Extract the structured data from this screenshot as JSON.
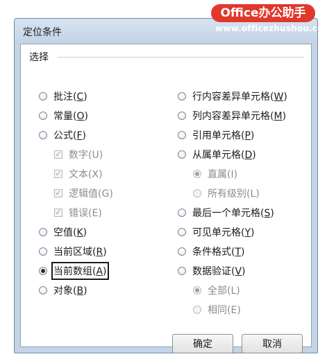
{
  "watermark": {
    "brand": "Office办公助手",
    "url": "www.officezhushou.com"
  },
  "dialog": {
    "title": "定位条件",
    "group_label": "选择"
  },
  "left_options": [
    {
      "label": "批注",
      "key": "C"
    },
    {
      "label": "常量",
      "key": "O"
    },
    {
      "label": "公式",
      "key": "F"
    },
    {
      "label": "空值",
      "key": "K"
    },
    {
      "label": "当前区域",
      "key": "R"
    },
    {
      "label": "当前数组",
      "key": "A"
    },
    {
      "label": "对象",
      "key": "B"
    }
  ],
  "formula_checks": [
    {
      "label": "数字",
      "key": "U"
    },
    {
      "label": "文本",
      "key": "X"
    },
    {
      "label": "逻辑值",
      "key": "G"
    },
    {
      "label": "错误",
      "key": "E"
    }
  ],
  "right_options": [
    {
      "label": "行内容差异单元格",
      "key": "W"
    },
    {
      "label": "列内容差异单元格",
      "key": "M"
    },
    {
      "label": "引用单元格",
      "key": "P"
    },
    {
      "label": "从属单元格",
      "key": "D"
    },
    {
      "label": "最后一个单元格",
      "key": "S"
    },
    {
      "label": "可见单元格",
      "key": "Y"
    },
    {
      "label": "条件格式",
      "key": "T"
    },
    {
      "label": "数据验证",
      "key": "V"
    }
  ],
  "dependents_sub": [
    {
      "label": "直属",
      "key": "I"
    },
    {
      "label": "所有级别",
      "key": "L"
    }
  ],
  "validation_sub": [
    {
      "label": "全部",
      "key": "L"
    },
    {
      "label": "相同",
      "key": "E"
    }
  ],
  "buttons": {
    "ok": "确定",
    "cancel": "取消"
  },
  "selected_option": "当前数组"
}
